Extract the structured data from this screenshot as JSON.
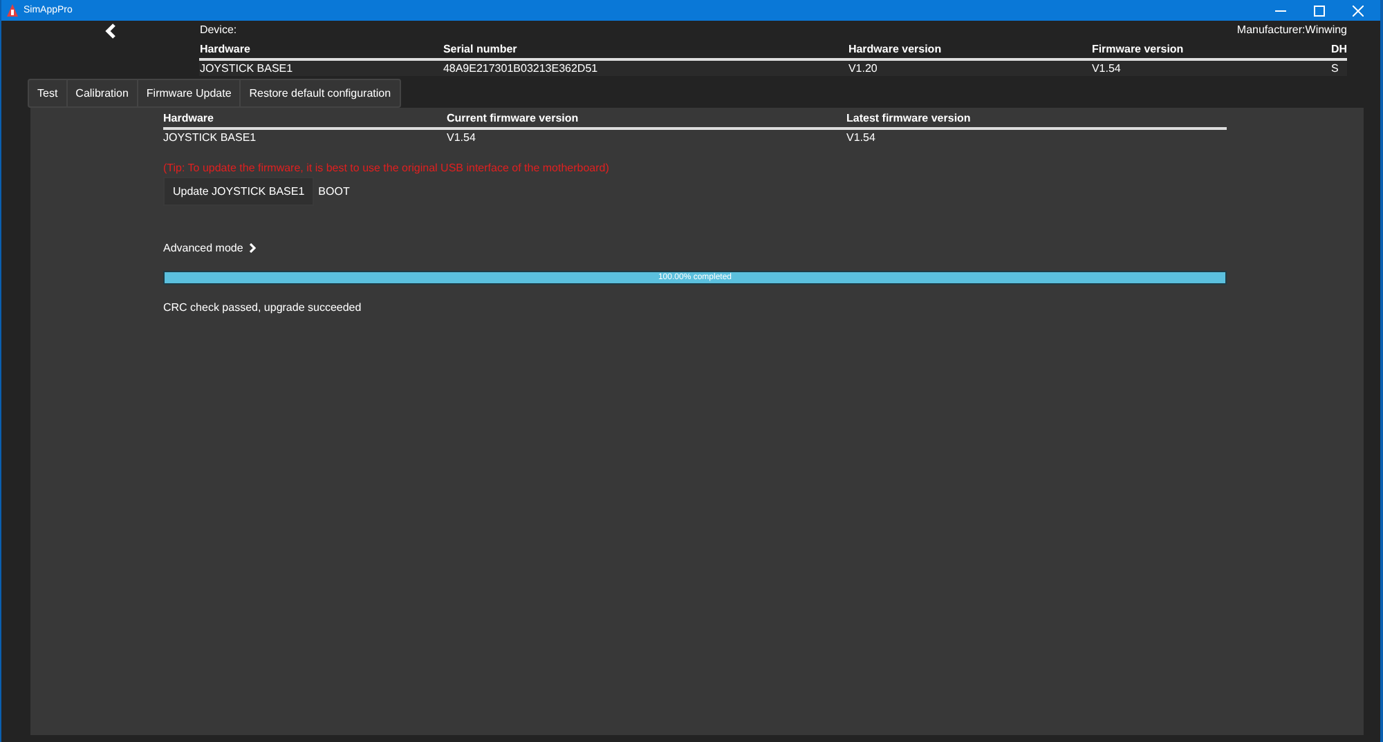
{
  "window": {
    "title": "SimAppPro"
  },
  "device": {
    "label": "Device:",
    "manufacturer": "Manufacturer:Winwing",
    "columns": [
      "Hardware",
      "Serial number",
      "Hardware version",
      "Firmware version",
      "DH"
    ],
    "rows": [
      [
        "JOYSTICK BASE1",
        "48A9E217301B03213E362D51",
        "V1.20",
        "V1.54",
        "S"
      ]
    ]
  },
  "tabs": [
    "Test",
    "Calibration",
    "Firmware Update",
    "Restore default configuration"
  ],
  "firmware": {
    "columns": [
      "Hardware",
      "Current firmware version",
      "Latest firmware version"
    ],
    "rows": [
      [
        "JOYSTICK BASE1",
        "V1.54",
        "V1.54"
      ]
    ],
    "tip": "(Tip: To update the firmware, it is best to use the original USB interface of the motherboard)",
    "update_button": "Update JOYSTICK BASE1",
    "mode_label": "BOOT",
    "advanced": "Advanced mode",
    "progress": {
      "level": 1,
      "label": "100.00% completed"
    },
    "status": "CRC check passed, upgrade succeeded"
  }
}
